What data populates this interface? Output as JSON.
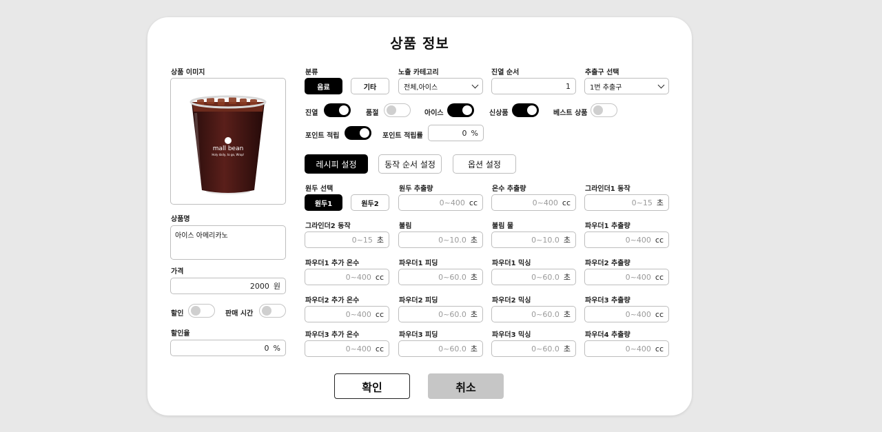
{
  "title": "상품 정보",
  "left": {
    "image_label": "상품 이미지",
    "cup_brand": "mall bean",
    "cup_tagline": "Holy daily, to go, Wrap!",
    "name_label": "상품명",
    "name_value": "아이스 아메리카노",
    "price_label": "가격",
    "price_value": "2000",
    "price_unit": "원",
    "discount_label": "할인",
    "sale_time_label": "판매 시간",
    "discount_rate_label": "할인율",
    "discount_rate_value": "0",
    "discount_rate_unit": "%"
  },
  "top": {
    "category_label": "분류",
    "category_options": [
      "음료",
      "기타"
    ],
    "expose_label": "노출 카테고리",
    "expose_value": "전체,아이스",
    "order_label": "진열 순서",
    "order_value": "1",
    "dispenser_label": "추출구 선택",
    "dispenser_value": "1번 추출구"
  },
  "toggles": {
    "display": "진열",
    "soldout": "품절",
    "ice": "아이스",
    "new": "신상품",
    "best": "베스트 상품",
    "point": "포인트 적립",
    "point_rate_label": "포인트 적립률",
    "point_rate_value": "0",
    "point_rate_unit": "%"
  },
  "tabs": [
    "레시피 설정",
    "동작 순서 설정",
    "옵션 설정"
  ],
  "recipe": {
    "bean_label": "원두 선택",
    "bean_options": [
      "원두1",
      "원두2"
    ],
    "fields": [
      {
        "label": "원두 추출량",
        "placeholder": "0~400",
        "unit": "cc"
      },
      {
        "label": "온수 추출량",
        "placeholder": "0~400",
        "unit": "cc"
      },
      {
        "label": "그라인더1 동작",
        "placeholder": "0~15",
        "unit": "초"
      },
      {
        "label": "그라인더2 동작",
        "placeholder": "0~15",
        "unit": "초"
      },
      {
        "label": "불림",
        "placeholder": "0~10.0",
        "unit": "초"
      },
      {
        "label": "불림 물",
        "placeholder": "0~10.0",
        "unit": "초"
      },
      {
        "label": "파우더1 추출량",
        "placeholder": "0~400",
        "unit": "cc"
      },
      {
        "label": "파우더1 추가 온수",
        "placeholder": "0~400",
        "unit": "cc"
      },
      {
        "label": "파우더1 피딩",
        "placeholder": "0~60.0",
        "unit": "초"
      },
      {
        "label": "파우더1 믹싱",
        "placeholder": "0~60.0",
        "unit": "초"
      },
      {
        "label": "파우더2 추출량",
        "placeholder": "0~400",
        "unit": "cc"
      },
      {
        "label": "파우더2 추가 온수",
        "placeholder": "0~400",
        "unit": "cc"
      },
      {
        "label": "파우더2 피딩",
        "placeholder": "0~60.0",
        "unit": "초"
      },
      {
        "label": "파우더2 믹싱",
        "placeholder": "0~60.0",
        "unit": "초"
      },
      {
        "label": "파우더3 추출량",
        "placeholder": "0~400",
        "unit": "cc"
      },
      {
        "label": "파우더3 추가 온수",
        "placeholder": "0~400",
        "unit": "cc"
      },
      {
        "label": "파우더3 피딩",
        "placeholder": "0~60.0",
        "unit": "초"
      },
      {
        "label": "파우더3 믹싱",
        "placeholder": "0~60.0",
        "unit": "초"
      },
      {
        "label": "파우더4 추출량",
        "placeholder": "0~400",
        "unit": "cc"
      }
    ]
  },
  "buttons": {
    "confirm": "확인",
    "cancel": "취소"
  }
}
